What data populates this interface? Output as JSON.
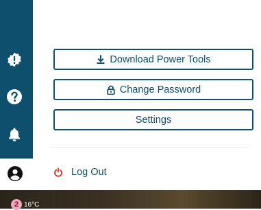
{
  "menu": {
    "download_label": "Download Power Tools",
    "password_label": "Change Password",
    "settings_label": "Settings",
    "logout_label": "Log Out"
  },
  "icons": {
    "alert": "alert-badge-icon",
    "help": "help-icon",
    "notifications": "bell-icon",
    "profile": "user-circle-icon",
    "download": "download-icon",
    "lock": "lock-icon",
    "power": "power-icon"
  },
  "taskbar": {
    "weather_badge": "2",
    "weather_temp": "16°C"
  },
  "colors": {
    "brand": "#0d4f6c",
    "logout_icon": "#e0311f",
    "background": "#ffffff"
  }
}
